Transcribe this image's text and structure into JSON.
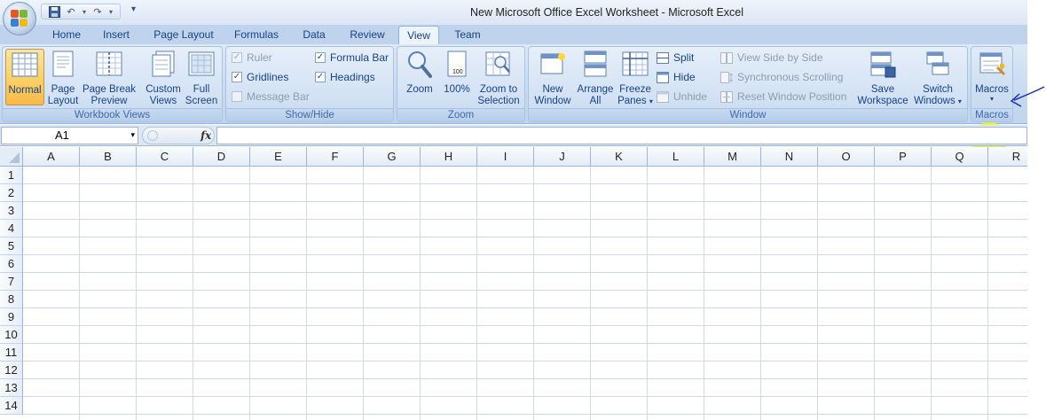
{
  "window": {
    "title": "New Microsoft Office Excel Worksheet - Microsoft Excel"
  },
  "qat": {
    "save": "💾",
    "undo": "↶",
    "undo_arrow": "▾",
    "redo": "↷",
    "redo_arrow": "▾",
    "customize": "▾"
  },
  "tabs": [
    "Home",
    "Insert",
    "Page Layout",
    "Formulas",
    "Data",
    "Review",
    "View",
    "Team"
  ],
  "active_tab": "View",
  "groups": {
    "workbook_views": {
      "label": "Workbook Views",
      "buttons": {
        "normal": "Normal",
        "page_layout_1": "Page",
        "page_layout_2": "Layout",
        "page_break_1": "Page Break",
        "page_break_2": "Preview",
        "custom_views_1": "Custom",
        "custom_views_2": "Views",
        "full_screen_1": "Full",
        "full_screen_2": "Screen"
      }
    },
    "show_hide": {
      "label": "Show/Hide",
      "ruler": "Ruler",
      "gridlines": "Gridlines",
      "message_bar": "Message Bar",
      "formula_bar": "Formula Bar",
      "headings": "Headings",
      "check": "✓"
    },
    "zoom": {
      "label": "Zoom",
      "zoom": "Zoom",
      "zoom100": "100%",
      "zoom_to_1": "Zoom to",
      "zoom_to_2": "Selection",
      "page_100": "100"
    },
    "window": {
      "label": "Window",
      "new_1": "New",
      "new_2": "Window",
      "arrange_1": "Arrange",
      "arrange_2": "All",
      "freeze_1": "Freeze",
      "freeze_2": "Panes",
      "split": "Split",
      "hide": "Hide",
      "unhide": "Unhide",
      "side_by_side": "View Side by Side",
      "sync": "Synchronous Scrolling",
      "reset": "Reset Window Position",
      "save_1": "Save",
      "save_2": "Workspace",
      "switch_1": "Switch",
      "switch_2": "Windows",
      "dropdown": "▾"
    },
    "macros": {
      "label": "Macros",
      "button": "Macros",
      "dropdown": "▾"
    }
  },
  "formula_bar": {
    "name_box": "A1",
    "name_arrow": "▾",
    "fx": "fx",
    "value": ""
  },
  "columns": [
    "A",
    "B",
    "C",
    "D",
    "E",
    "F",
    "G",
    "H",
    "I",
    "J",
    "K",
    "L",
    "M",
    "N",
    "O",
    "P",
    "Q",
    "R"
  ],
  "rows": [
    "1",
    "2",
    "3",
    "4",
    "5",
    "6",
    "7",
    "8",
    "9",
    "10",
    "11",
    "12",
    "13",
    "14"
  ],
  "colors": {
    "highlight": "#ecf41f",
    "annotation_arrow": "#1a2fb0"
  }
}
